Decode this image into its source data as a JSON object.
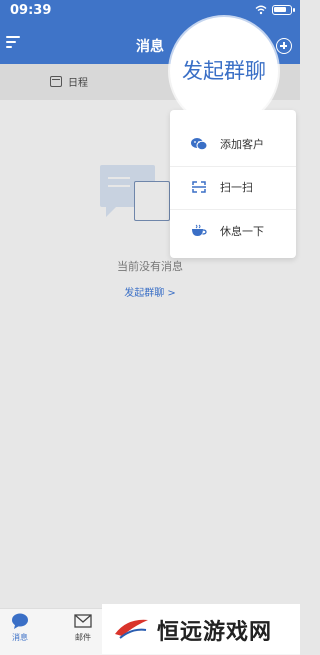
{
  "status_bar": {
    "time": "09:39"
  },
  "header": {
    "title": "消息"
  },
  "tabs": {
    "schedule_label": "日程"
  },
  "empty_state": {
    "message": "当前没有消息",
    "link_label": "发起群聊 >"
  },
  "popup_menu": {
    "zoom_label": "发起群聊",
    "items": [
      {
        "label": "添加客户",
        "icon": "wechat-icon"
      },
      {
        "label": "扫一扫",
        "icon": "scan-icon"
      },
      {
        "label": "休息一下",
        "icon": "coffee-cup-icon"
      }
    ]
  },
  "bottom_tabs": [
    {
      "label": "消息",
      "icon": "chat-bubble-icon",
      "active": true
    },
    {
      "label": "邮件",
      "icon": "mail-icon",
      "active": false
    }
  ],
  "watermark": {
    "text": "恒远游戏网"
  },
  "colors": {
    "primary": "#3f74c8",
    "link": "#3a6fc6",
    "background": "#e7e7e7"
  }
}
